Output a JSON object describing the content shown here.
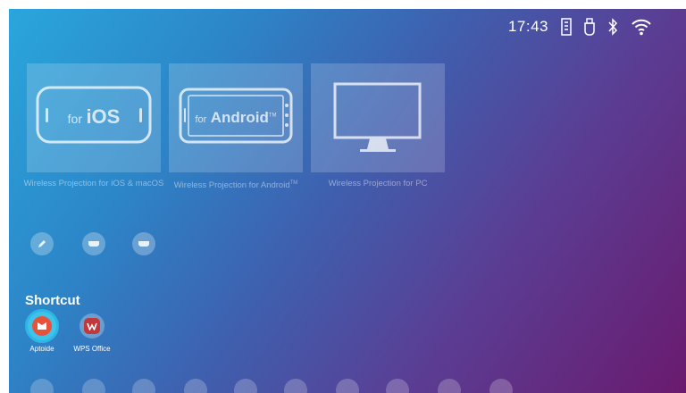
{
  "status": {
    "time": "17:43",
    "icons": [
      "storage-icon",
      "usb-icon",
      "bluetooth-icon",
      "wifi-icon"
    ]
  },
  "cards": [
    {
      "name": "ios",
      "tag": "for",
      "main": "iOS",
      "label": "Wireless Projection for iOS & macOS"
    },
    {
      "name": "android",
      "tag": "for",
      "main": "Android",
      "tm": "TM",
      "label": "Wireless Projection for Android",
      "label_tm": "TM"
    },
    {
      "name": "pc",
      "label": "Wireless Projection for PC"
    }
  ],
  "row_icons": [
    "brush-icon",
    "hdmi-icon",
    "hdmi-icon"
  ],
  "shortcut": {
    "title": "Shortcut",
    "apps": [
      {
        "label": "Aptoide",
        "icon": "aptoide-icon",
        "color": "#e8523a"
      },
      {
        "label": "WPS Office",
        "icon": "wps-office-icon",
        "color": "#c2373b"
      }
    ]
  },
  "bottom_icons": [
    "settings-icon",
    "network-icon",
    "bluetooth-icon",
    "image-icon",
    "audio-icon",
    "display-icon",
    "update-icon",
    "apps-icon",
    "android-icon",
    "storage-icon"
  ],
  "colors": {
    "accent": "#2bb6e6",
    "bg_start": "#2aa6dc",
    "bg_end": "#6a1a6e"
  }
}
